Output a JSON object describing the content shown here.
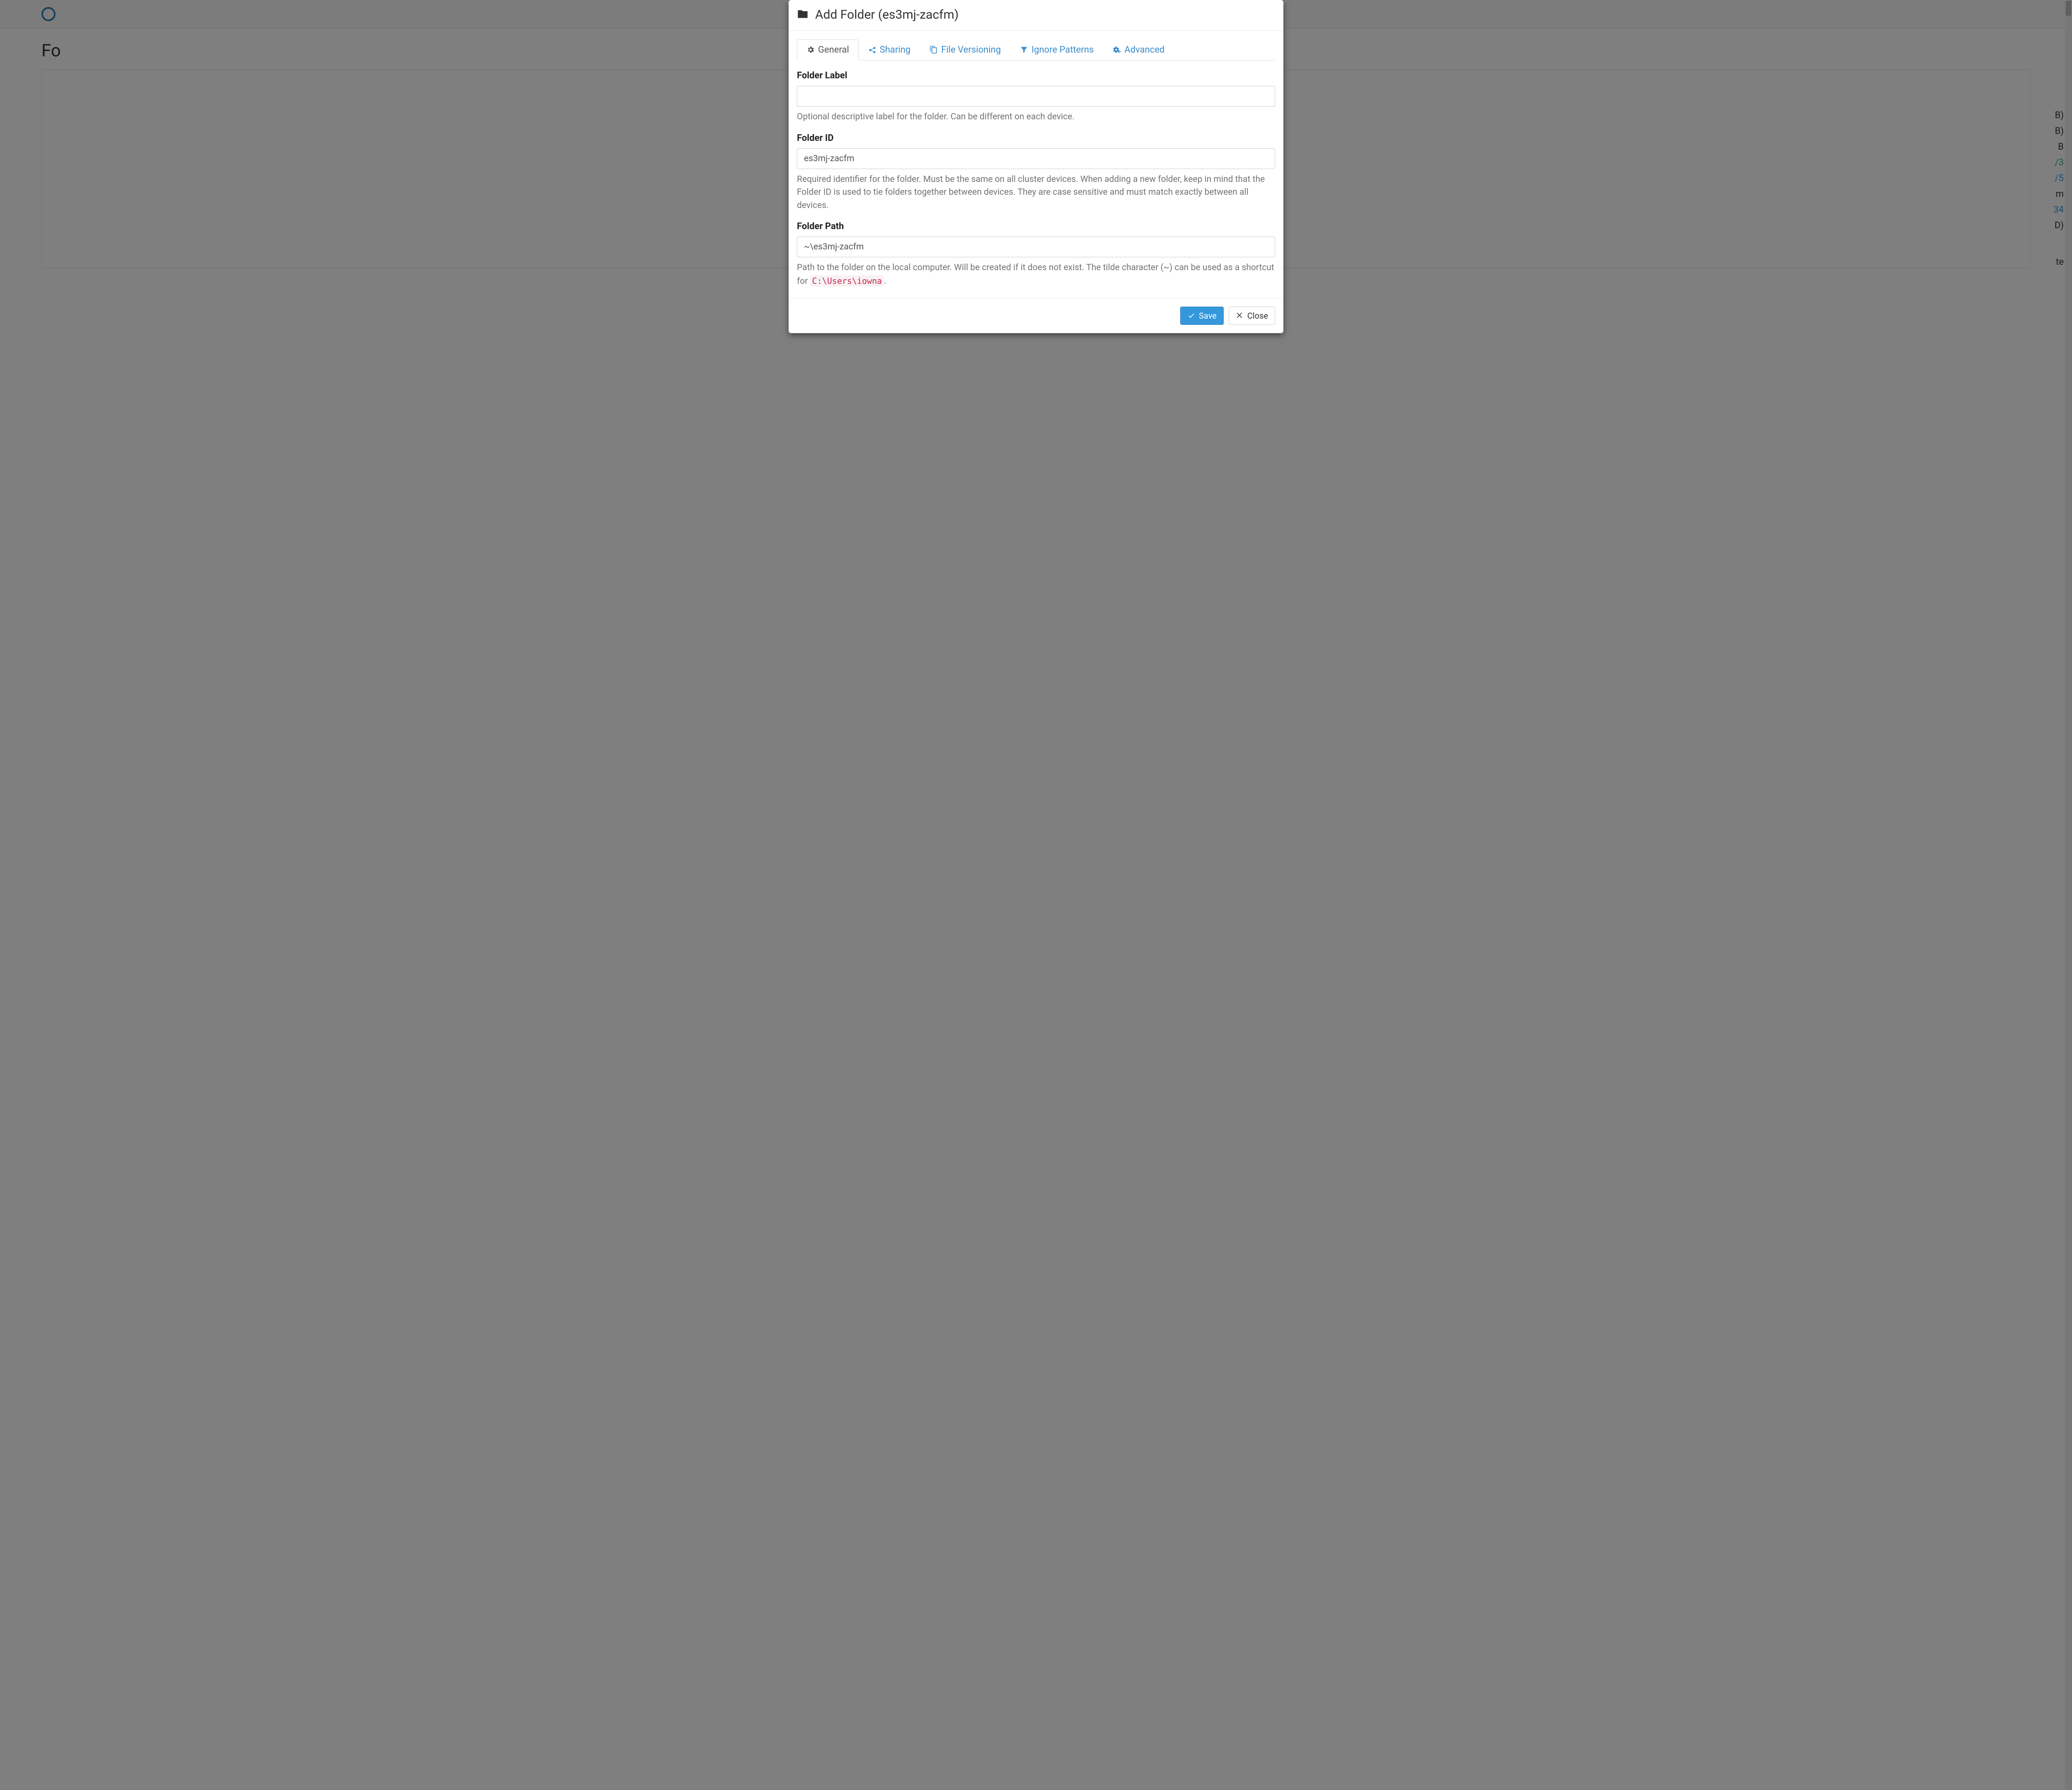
{
  "modal": {
    "title": "Add Folder (es3mj-zacfm)"
  },
  "tabs": {
    "general": "General",
    "sharing": "Sharing",
    "versioning": "File Versioning",
    "ignore": "Ignore Patterns",
    "advanced": "Advanced"
  },
  "form": {
    "folder_label": {
      "label": "Folder Label",
      "value": "",
      "help": "Optional descriptive label for the folder. Can be different on each device."
    },
    "folder_id": {
      "label": "Folder ID",
      "value": "es3mj-zacfm",
      "help": "Required identifier for the folder. Must be the same on all cluster devices. When adding a new folder, keep in mind that the Folder ID is used to tie folders together between devices. They are case sensitive and must match exactly between all devices."
    },
    "folder_path": {
      "label": "Folder Path",
      "value": "~\\es3mj-zacfm",
      "help_pre": "Path to the folder on the local computer. Will be created if it does not exist. The tilde character (~) can be used as a shortcut for ",
      "help_code": "C:\\Users\\iowna",
      "help_post": "."
    }
  },
  "buttons": {
    "save": "Save",
    "close": "Close"
  },
  "bg": {
    "heading_fragment": "Fo",
    "right_col": [
      "B)",
      "B)",
      "B",
      "/3",
      "/5",
      "m",
      "34",
      "D)",
      "te"
    ]
  }
}
